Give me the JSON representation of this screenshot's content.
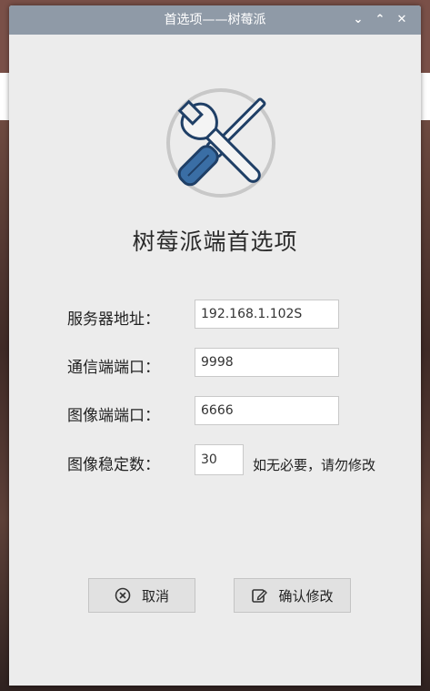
{
  "window": {
    "title": "首选项——树莓派",
    "controls": {
      "minimize": "⌄",
      "maximize": "⌃",
      "close": "✕"
    }
  },
  "logo_icon": "tools-icon (wrench and screwdriver)",
  "heading": "树莓派端首选项",
  "form": {
    "server_address": {
      "label": "服务器地址：",
      "value": "192.168.1.102S"
    },
    "comm_port": {
      "label": "通信端端口：",
      "value": "9998"
    },
    "image_port": {
      "label": "图像端端口：",
      "value": "6666"
    },
    "image_stable_count": {
      "label": "图像稳定数：",
      "value": "30",
      "hint": "如无必要，请勿修改"
    }
  },
  "buttons": {
    "cancel": {
      "label": "取消",
      "icon": "cancel-circle-icon"
    },
    "confirm": {
      "label": "确认修改",
      "icon": "edit-icon"
    }
  },
  "colors": {
    "titlebar": "#8f9aa7",
    "window_bg": "#ececec",
    "icon_blue": "#3a6ea5",
    "icon_outline": "#1f3f66"
  }
}
